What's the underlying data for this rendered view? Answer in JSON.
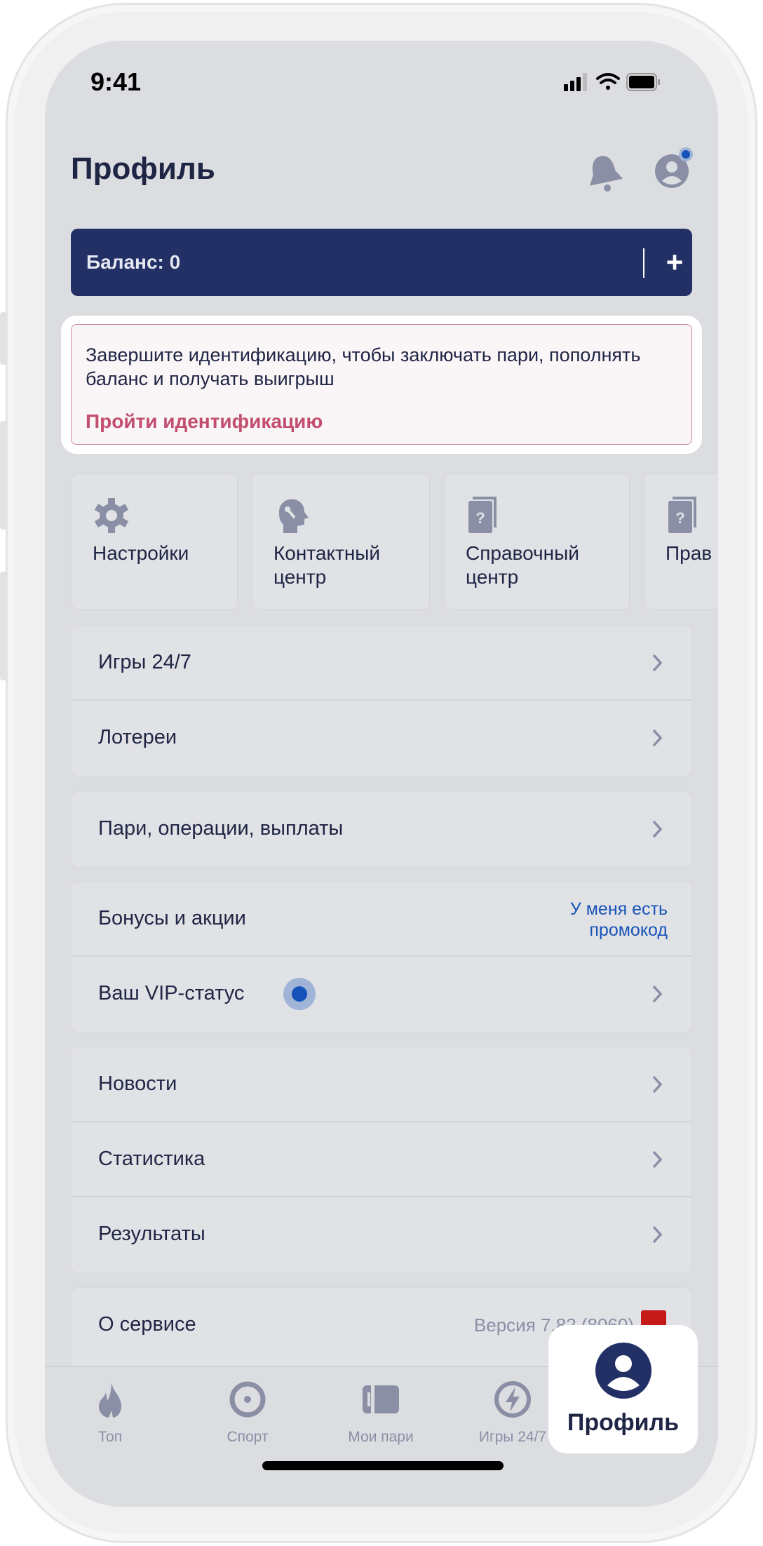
{
  "status_bar": {
    "time": "9:41",
    "icons": [
      "cellular-signal-icon",
      "wifi-icon",
      "battery-icon"
    ]
  },
  "header": {
    "title": "Профиль",
    "icons": [
      "bell-icon",
      "avatar-icon"
    ],
    "notification_dot_color": "#1451b8"
  },
  "balance": {
    "label": "Баланс: 0",
    "add_label": "+",
    "color": "#223066"
  },
  "identification": {
    "message": "Завершите идентификацию, чтобы заключать пари, пополнять баланс и получать выигрыш",
    "link": "Пройти идентификацию",
    "link_color": "#c24d6e"
  },
  "shortcuts": [
    {
      "label": "Настройки",
      "icon": "gear-icon"
    },
    {
      "label": "Контактный\nцентр",
      "icon": "head-support-icon"
    },
    {
      "label": "Справочный\nцентр",
      "icon": "help-book-icon"
    },
    {
      "label": "Прав",
      "icon": "help-book-icon"
    }
  ],
  "groups": [
    [
      {
        "label": "Игры 24/7"
      },
      {
        "label": "Лотереи"
      }
    ],
    [
      {
        "label": "Пари, операции, выплаты"
      }
    ],
    [
      {
        "label": "Бонусы и акции",
        "promo": "У меня есть промокод"
      },
      {
        "label": "Ваш VIP-статус"
      }
    ],
    [
      {
        "label": "Новости"
      },
      {
        "label": "Статистика"
      },
      {
        "label": "Результаты"
      }
    ],
    [
      {
        "label": "О сервисе",
        "version": "Версия 7.82 (8060)"
      }
    ]
  ],
  "tabbar": {
    "tabs": [
      {
        "label": "Топ",
        "icon": "flame-icon"
      },
      {
        "label": "Спорт",
        "icon": "target-icon"
      },
      {
        "label": "Мои пари",
        "icon": "ticket-icon"
      },
      {
        "label": "Игры 24/7",
        "icon": "lightning-icon"
      }
    ],
    "active": {
      "label": "Профиль",
      "icon": "profile-icon"
    }
  }
}
